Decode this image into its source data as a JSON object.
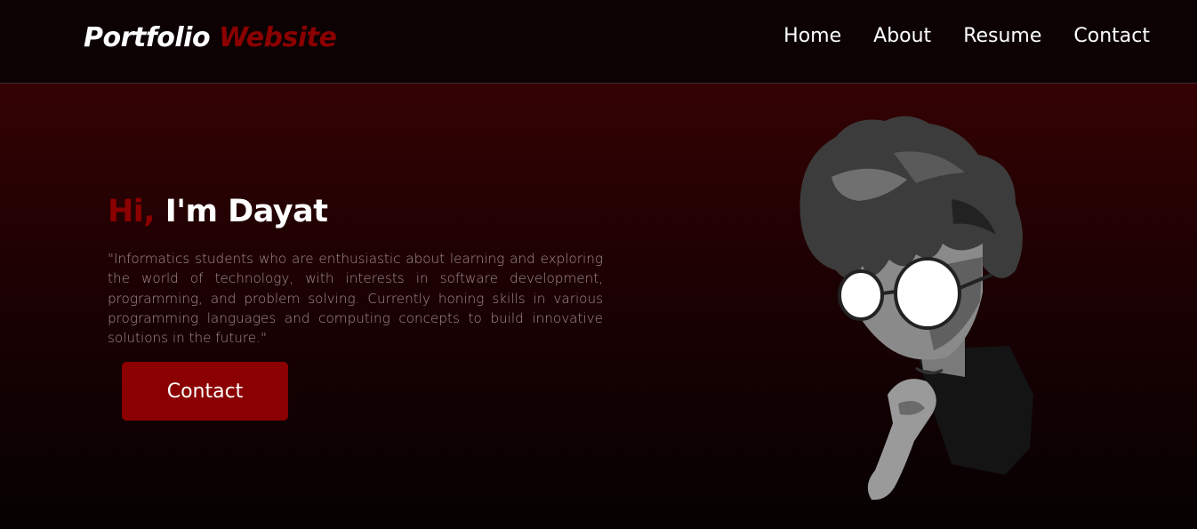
{
  "header": {
    "logo": {
      "part1": "Portfolio",
      "part2": "Website"
    },
    "nav": [
      "Home",
      "About",
      "Resume",
      "Contact"
    ]
  },
  "hero": {
    "greeting_accent": "Hi,",
    "greeting_name": "I'm Dayat",
    "bio": "\"Informatics students who are enthusiastic about learning and exploring the world of technology, with interests in software development, programming, and problem solving. Currently honing skills in various programming languages and computing concepts to build innovative solutions in the future.\"",
    "button_label": "Contact",
    "avatar": "profile-illustration"
  },
  "colors": {
    "accent": "#8b0000",
    "header_bg": "#0c0203",
    "hero_top": "#340203",
    "hero_bottom": "#060102"
  }
}
